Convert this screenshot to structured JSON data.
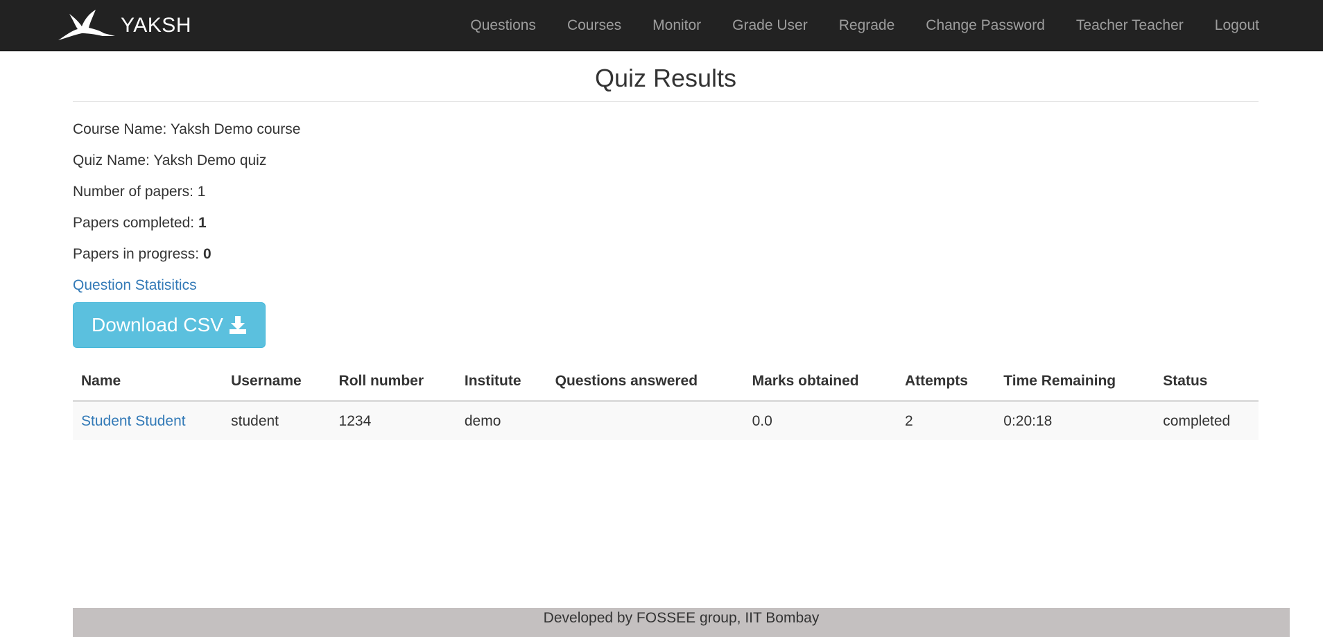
{
  "brand": {
    "name": "YAKSH",
    "logo_icon": "flying-bird-icon"
  },
  "nav": {
    "items": [
      {
        "label": "Questions"
      },
      {
        "label": "Courses"
      },
      {
        "label": "Monitor"
      },
      {
        "label": "Grade User"
      },
      {
        "label": "Regrade"
      },
      {
        "label": "Change Password"
      },
      {
        "label": "Teacher Teacher"
      },
      {
        "label": "Logout"
      }
    ]
  },
  "page": {
    "title": "Quiz Results",
    "course_label": "Course Name: ",
    "course_value": "Yaksh Demo course",
    "quiz_label": "Quiz Name: ",
    "quiz_value": "Yaksh Demo quiz",
    "papers_label": "Number of papers: ",
    "papers_value": "1",
    "completed_label": "Papers completed: ",
    "completed_value": "1",
    "in_progress_label": "Papers in progress: ",
    "in_progress_value": "0",
    "stats_link": "Question Statisitics",
    "download_label": "Download CSV",
    "download_icon": "download-icon"
  },
  "table": {
    "headers": {
      "name": "Name",
      "username": "Username",
      "roll": "Roll number",
      "institute": "Institute",
      "answered": "Questions answered",
      "marks": "Marks obtained",
      "attempts": "Attempts",
      "time": "Time Remaining",
      "status": "Status"
    },
    "rows": [
      {
        "name": "Student Student",
        "username": "student",
        "roll": "1234",
        "institute": "demo",
        "answered": "",
        "marks": "0.0",
        "attempts": "2",
        "time": "0:20:18",
        "status": "completed"
      }
    ]
  },
  "footer": {
    "text": "Developed by FOSSEE group, IIT Bombay"
  },
  "colors": {
    "navbar_bg": "#222222",
    "link": "#337ab7",
    "button_info": "#5bc0de",
    "footer_bg": "#c4c0c0"
  }
}
